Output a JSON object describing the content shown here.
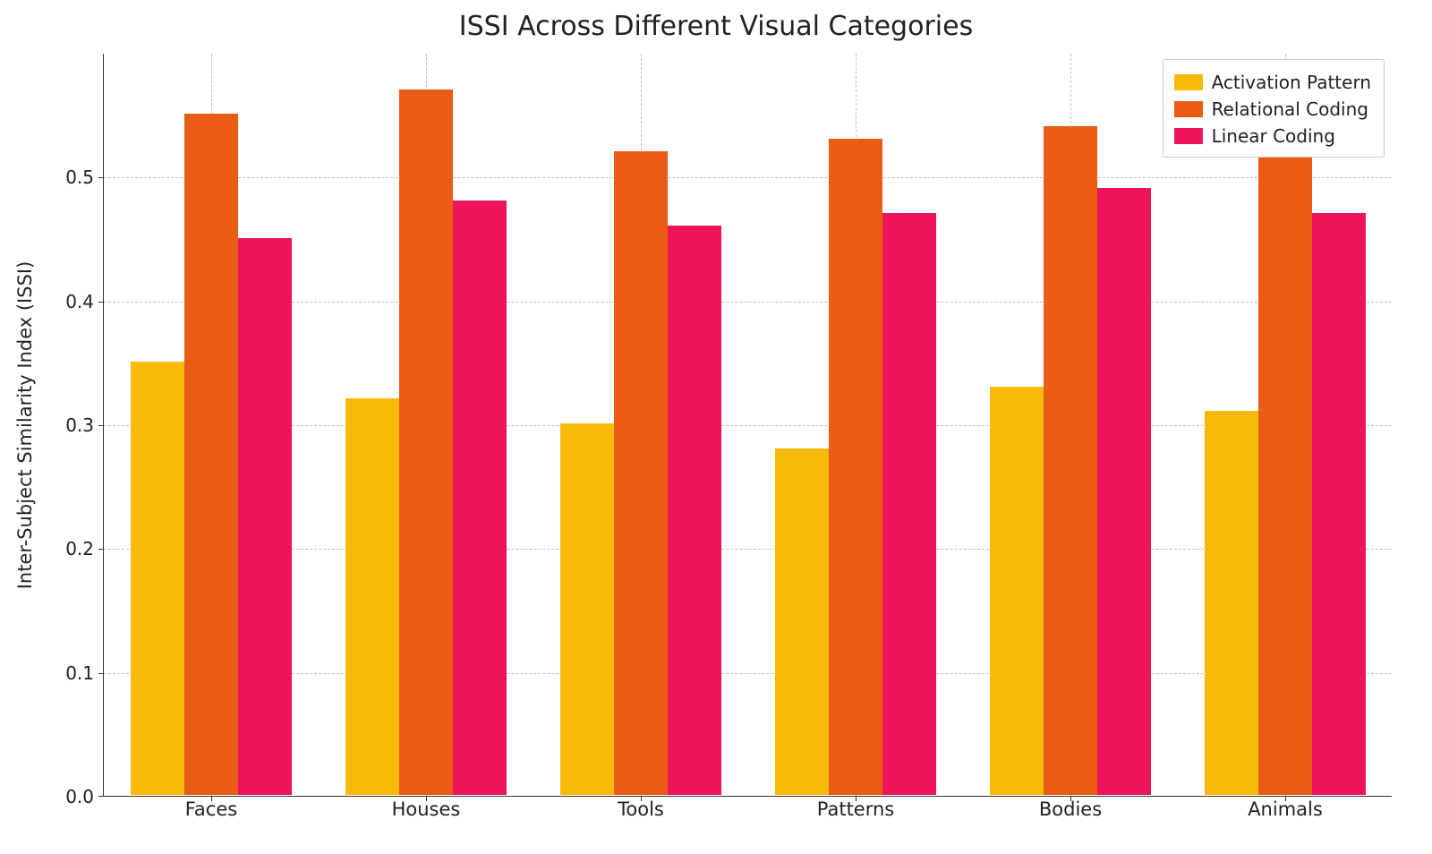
{
  "chart_data": {
    "type": "bar",
    "title": "ISSI Across Different Visual Categories",
    "xlabel": "",
    "ylabel": "Inter-Subject Similarity Index (ISSI)",
    "categories": [
      "Faces",
      "Houses",
      "Tools",
      "Patterns",
      "Bodies",
      "Animals"
    ],
    "series": [
      {
        "name": "Activation Pattern",
        "color": "#f9b908",
        "values": [
          0.35,
          0.32,
          0.3,
          0.28,
          0.33,
          0.31
        ]
      },
      {
        "name": "Relational Coding",
        "color": "#ea5b15",
        "values": [
          0.55,
          0.57,
          0.52,
          0.53,
          0.54,
          0.56
        ]
      },
      {
        "name": "Linear Coding",
        "color": "#ed1459",
        "values": [
          0.45,
          0.48,
          0.46,
          0.47,
          0.49,
          0.47
        ]
      }
    ],
    "ylim": [
      0.0,
      0.6
    ],
    "yticks": [
      0.0,
      0.1,
      0.2,
      0.3,
      0.4,
      0.5
    ],
    "ytick_labels": [
      "0.0",
      "0.1",
      "0.2",
      "0.3",
      "0.4",
      "0.5"
    ],
    "grid": true,
    "legend_position": "upper right"
  }
}
